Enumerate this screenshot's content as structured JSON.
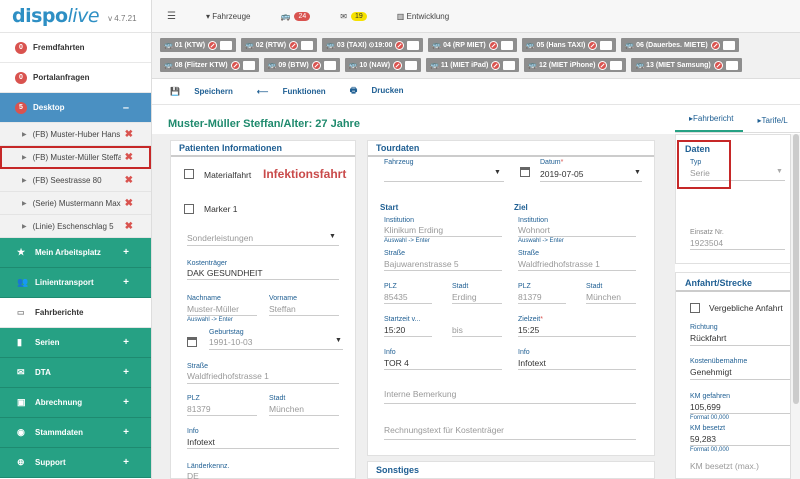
{
  "app": {
    "logo_main": "dispo",
    "logo_live": "live",
    "version": "v 4.7.21"
  },
  "sidebar": {
    "fremdfahrten": {
      "count": "0",
      "label": "Fremdfahrten"
    },
    "portalanfragen": {
      "count": "0",
      "label": "Portalanfragen"
    },
    "desktop": {
      "count": "5",
      "label": "Desktop",
      "toggle": "–"
    },
    "desktop_items": [
      {
        "label": "(FB) Muster-Huber Hans"
      },
      {
        "label": "(FB) Muster-Müller Steffan"
      },
      {
        "label": "(FB) Seestrasse 80"
      },
      {
        "label": "(Serie) Mustermann Max"
      },
      {
        "label": "(Linie) Eschenschlag 5"
      }
    ],
    "sections": [
      {
        "label": "Mein Arbeitsplatz",
        "icon": "star-icon"
      },
      {
        "label": "Linientransport",
        "icon": "users-icon"
      }
    ],
    "fahrberichte": "Fahrberichte",
    "sections2": [
      {
        "label": "Serien"
      },
      {
        "label": "DTA"
      },
      {
        "label": "Abrechnung"
      },
      {
        "label": "Stammdaten"
      },
      {
        "label": "Support"
      }
    ]
  },
  "topbar": {
    "fahrzeuge": "Fahrzeuge",
    "bus_count": "24",
    "mail_count": "19",
    "entwicklung": "Entwicklung"
  },
  "vehicles": {
    "row1": [
      "01 (KTW)",
      "02 (RTW)",
      "03 (TAXI) ⊙19:00",
      "04 (RP MIET)",
      "05 (Hans TAXI)",
      "06 (Dauerbes. MIETE)"
    ],
    "row2": [
      "08 (Flitzer KTW)",
      "09 (BTW)",
      "10 (NAW)",
      "11 (MIET iPad)",
      "12 (MIET iPhone)",
      "13 (MIET Samsung)"
    ]
  },
  "actions": {
    "save": "Speichern",
    "functions": "Funktionen",
    "print": "Drucken"
  },
  "main_title": "Muster-Müller Steffan/Alter: 27 Jahre",
  "patient": {
    "head": "Patienten Informationen",
    "materialfahrt": "Materialfahrt",
    "infektionsfahrt": "Infektionsfahrt",
    "marker1": "Marker 1",
    "sonderleistungen": "Sonderleistungen",
    "kostentraeger_label": "Kostenträger",
    "kostentraeger": "DAK GESUNDHEIT",
    "nachname_label": "Nachname",
    "nachname": "Muster-Müller",
    "vorname_label": "Vorname",
    "vorname": "Steffan",
    "auswahl_hint": "Auswahl -> Enter",
    "geburtstag_label": "Geburtstag",
    "geburtstag": "1991-10-03",
    "strasse_label": "Straße",
    "strasse": "Waldfriedhofstrasse 1",
    "plz_label": "PLZ",
    "plz": "81379",
    "stadt_label": "Stadt",
    "stadt": "München",
    "info_label": "Info",
    "info": "Infotext",
    "laenderkennz_label": "Länderkennz.",
    "laenderkennz": "DE"
  },
  "tour": {
    "head": "Tourdaten",
    "fahrzeug_label": "Fahrzeug",
    "datum_label": "Datum",
    "datum": "2019-07-05",
    "start": "Start",
    "ziel": "Ziel",
    "inst_label": "Institution",
    "start_inst": "Klinikum Erding",
    "ziel_inst": "Wohnort",
    "auswahl_hint": "Auswahl -> Enter",
    "strasse_label": "Straße",
    "start_strasse": "Bajuwarenstrasse 5",
    "ziel_strasse": "Waldfriedhofstrasse 1",
    "plz_label": "PLZ",
    "stadt_label": "Stadt",
    "start_plz": "85435",
    "start_stadt": "Erding",
    "ziel_plz": "81379",
    "ziel_stadt": "München",
    "startzeit_label": "Startzeit v...",
    "startzeit": "15:20",
    "bis": "bis",
    "zielzeit_label": "Zielzeit",
    "zielzeit": "15:25",
    "info_label": "Info",
    "start_info": "TOR 4",
    "ziel_info": "Infotext",
    "interne": "Interne Bemerkung",
    "rechnungstext": "Rechnungstext für Kostenträger",
    "sonstiges": "Sonstiges"
  },
  "right": {
    "tab1": "Fahrbericht",
    "tab2": "Tarife/L",
    "daten_head": "Daten",
    "typ_label": "Typ",
    "typ": "Serie",
    "einsatz_label": "Einsatz Nr.",
    "einsatz": "1923504",
    "anfahrt_head": "Anfahrt/Strecke",
    "vergebliche": "Vergebliche Anfahrt",
    "richtung_label": "Richtung",
    "richtung": "Rückfahrt",
    "kosten_label": "Kostenübernahme",
    "kosten": "Genehmigt",
    "km_gef_label": "KM gefahren",
    "km_gef": "105,699",
    "format_hint": "Format 00,000",
    "km_bes_label": "KM besetzt",
    "km_bes": "59,283",
    "km_bes_max": "KM besetzt (max.)"
  }
}
